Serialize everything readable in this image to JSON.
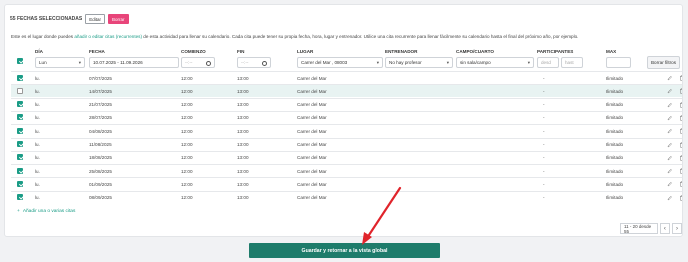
{
  "selection": {
    "count_label": "55 FECHAS SELECCIONADAS",
    "edit_label": "Editar",
    "delete_label": "Borrar"
  },
  "intro": {
    "before": "Este es el lugar donde puedes",
    "link": "añadir o editar citas (recurrentes)",
    "after": "de esta actividad para llenar su calendario. Cada cita puede tener su propia fecha, hora, lugar y entrenador. Utilice una cita recurrente para llenar fácilmente su calendario hasta el final del próximo año, por ejemplo."
  },
  "columns": {
    "day": "Día",
    "date": "Fecha",
    "start": "Comienzo",
    "end": "Fin",
    "place": "Lugar",
    "trainer": "Entrenador",
    "field": "Campo/cuarto",
    "participants": "Participantes",
    "max": "Max"
  },
  "filters": {
    "day": "Lun",
    "date_range": "10.07.2025 - 11.09.2026",
    "start_placeholder": "--:--",
    "end_placeholder": "--:--",
    "place": "Carrer del Mar , 08003",
    "trainer": "No hay profesor",
    "field": "sin sala/campo",
    "participants_from": "desd",
    "participants_to": "hast",
    "reset_label": "Borrar filtros"
  },
  "rows": [
    {
      "checked": true,
      "day": "lu.",
      "date": "07/07/2025",
      "start": "12:00",
      "end": "13:00",
      "place": "Carrer del Mar",
      "participants": "-",
      "max": "Ilimitado",
      "highlight": false
    },
    {
      "checked": false,
      "day": "lu.",
      "date": "14/07/2025",
      "start": "12:00",
      "end": "13:00",
      "place": "Carrer del Mar",
      "participants": "-",
      "max": "Ilimitado",
      "highlight": true
    },
    {
      "checked": true,
      "day": "lu.",
      "date": "21/07/2025",
      "start": "12:00",
      "end": "13:00",
      "place": "Carrer del Mar",
      "participants": "-",
      "max": "Ilimitado",
      "highlight": false
    },
    {
      "checked": true,
      "day": "lu.",
      "date": "28/07/2025",
      "start": "12:00",
      "end": "13:00",
      "place": "Carrer del Mar",
      "participants": "-",
      "max": "Ilimitado",
      "highlight": false
    },
    {
      "checked": true,
      "day": "lu.",
      "date": "04/08/2025",
      "start": "12:00",
      "end": "13:00",
      "place": "Carrer del Mar",
      "participants": "-",
      "max": "Ilimitado",
      "highlight": false
    },
    {
      "checked": true,
      "day": "lu.",
      "date": "11/08/2025",
      "start": "12:00",
      "end": "13:00",
      "place": "Carrer del Mar",
      "participants": "-",
      "max": "Ilimitado",
      "highlight": false
    },
    {
      "checked": true,
      "day": "lu.",
      "date": "18/08/2025",
      "start": "12:00",
      "end": "13:00",
      "place": "Carrer del Mar",
      "participants": "-",
      "max": "Ilimitado",
      "highlight": false
    },
    {
      "checked": true,
      "day": "lu.",
      "date": "25/08/2025",
      "start": "12:00",
      "end": "13:00",
      "place": "Carrer del Mar",
      "participants": "-",
      "max": "Ilimitado",
      "highlight": false
    },
    {
      "checked": true,
      "day": "lu.",
      "date": "01/09/2025",
      "start": "12:00",
      "end": "13:00",
      "place": "Carrer del Mar",
      "participants": "-",
      "max": "Ilimitado",
      "highlight": false
    },
    {
      "checked": true,
      "day": "lu.",
      "date": "08/09/2025",
      "start": "12:00",
      "end": "13:00",
      "place": "Carrer del Mar",
      "participants": "-",
      "max": "Ilimitado",
      "highlight": false
    }
  ],
  "add_label": "Añadir una o varias citas",
  "pager": {
    "info": "11 - 20 desde 55",
    "prev": "‹",
    "next": "›"
  },
  "save_label": "Guardar y retornar a la vista global",
  "colors": {
    "accent": "#1a9c86",
    "save": "#1e7c6b",
    "delete": "#e8457a",
    "arrow": "#e0242b"
  },
  "icons": {
    "edit": "pencil-icon",
    "delete": "trash-icon",
    "add": "plus-icon"
  }
}
